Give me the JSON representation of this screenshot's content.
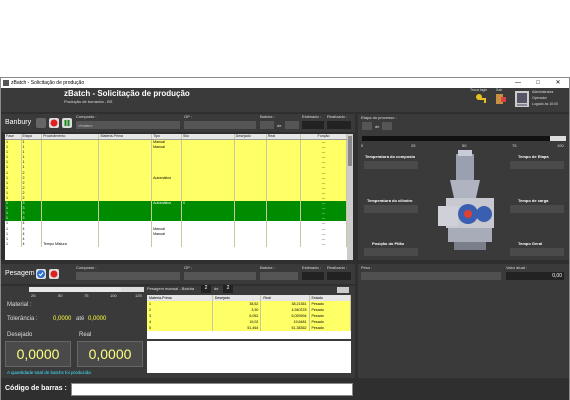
{
  "window": {
    "title": "zBatch - Solicitação de produção",
    "minimize": "—",
    "maximize": "□",
    "close": "✕"
  },
  "header": {
    "title": "zBatch - Solicitação de produção",
    "subtitle": "Produção de borracha - BS",
    "icons": [
      {
        "name": "troca-login",
        "label": "Troca login"
      },
      {
        "name": "sair",
        "label": "Sair"
      }
    ],
    "user": {
      "name": "Administrador",
      "role": "Operador",
      "login": "Logado às 10:00"
    }
  },
  "banbury": {
    "name": "Banbury",
    "composto_label": "Composto :",
    "composto_value": "Vedatex",
    "op_label": "OP :",
    "batcha_label": "Batcha :",
    "de": "de",
    "estimado_label": "Estimado :",
    "realizado_label": "Realizado :"
  },
  "grid": {
    "columns": [
      "Fase",
      "Etapa",
      "Procedimento",
      "Materia-Prima",
      "Tipo",
      "Silo",
      "Desejado",
      "Real",
      "Função"
    ],
    "rows": [
      {
        "style": "y",
        "cells": [
          "1",
          "1",
          "",
          "",
          "Manual",
          "",
          "",
          "",
          "---"
        ]
      },
      {
        "style": "y",
        "cells": [
          "1",
          "1",
          "",
          "",
          "Manual",
          "",
          "",
          "",
          "---"
        ]
      },
      {
        "style": "y",
        "cells": [
          "1",
          "1",
          "",
          "",
          "",
          "",
          "",
          "",
          "---"
        ]
      },
      {
        "style": "y",
        "cells": [
          "1",
          "1",
          "",
          "",
          "",
          "",
          "",
          "",
          "---"
        ]
      },
      {
        "style": "y",
        "cells": [
          "1",
          "1",
          "",
          "",
          "",
          "",
          "",
          "",
          "---"
        ]
      },
      {
        "style": "y",
        "cells": [
          "1",
          "1",
          "",
          "",
          "",
          "",
          "",
          "",
          "---"
        ]
      },
      {
        "style": "y",
        "cells": [
          "1",
          "2",
          "",
          "",
          "",
          "",
          "",
          "",
          "---"
        ]
      },
      {
        "style": "y",
        "cells": [
          "1",
          "2",
          "",
          "",
          "Automático",
          "",
          "",
          "",
          "---"
        ]
      },
      {
        "style": "y",
        "cells": [
          "1",
          "2",
          "",
          "",
          "",
          "",
          "",
          "",
          "---"
        ]
      },
      {
        "style": "y",
        "cells": [
          "1",
          "2",
          "",
          "",
          "",
          "",
          "",
          "",
          "---"
        ]
      },
      {
        "style": "y",
        "cells": [
          "1",
          "2",
          "",
          "",
          "",
          "",
          "",
          "",
          "---"
        ]
      },
      {
        "style": "y",
        "cells": [
          "1",
          "2",
          "",
          "",
          "",
          "",
          "",
          "",
          "---"
        ]
      },
      {
        "style": "g",
        "cells": [
          "1",
          "3",
          "",
          "",
          "Automático",
          "0",
          "",
          "",
          "---"
        ]
      },
      {
        "style": "g",
        "cells": [
          "1",
          "3",
          "",
          "",
          "",
          "",
          "",
          "",
          "---"
        ]
      },
      {
        "style": "g",
        "cells": [
          "1",
          "3",
          "",
          "",
          "",
          "",
          "",
          "",
          "---"
        ]
      },
      {
        "style": "g",
        "cells": [
          "1",
          "3",
          "",
          "",
          "",
          "",
          "",
          "",
          "---"
        ]
      },
      {
        "style": "w",
        "cells": [
          "1",
          "4",
          "",
          "",
          "",
          "",
          "",
          "",
          "---"
        ]
      },
      {
        "style": "w",
        "cells": [
          "1",
          "4",
          "",
          "",
          "Manual",
          "",
          "",
          "",
          "---"
        ]
      },
      {
        "style": "w",
        "cells": [
          "1",
          "4",
          "",
          "",
          "Manual",
          "",
          "",
          "",
          "---"
        ]
      },
      {
        "style": "w",
        "cells": [
          "1",
          "4",
          "",
          "",
          "",
          "",
          "",
          "",
          "---"
        ]
      },
      {
        "style": "w",
        "cells": [
          "1",
          "4",
          "Tempo Mistura",
          "",
          "",
          "",
          "",
          "",
          "---"
        ]
      }
    ]
  },
  "etapa": {
    "label": "Etapa do processo :",
    "de": "de",
    "scale": [
      "0",
      "25",
      "50",
      "75",
      "100"
    ],
    "progress": 0.92,
    "readouts": {
      "temp_composto": "Temperatura do composto",
      "tempo_etapa": "Tempo de Etapa",
      "temp_cilindro": "Temperatura do cilindro",
      "tempo_carga": "Tempo de carga",
      "posicao_pilao": "Posição do Pilão",
      "tempo_geral": "Tempo Geral"
    }
  },
  "pesagem": {
    "name": "Pesagem",
    "composto_label": "Composto :",
    "op_label": "OP :",
    "batcha_label": "Batcha :",
    "estimado_label": "Estimado :",
    "realizado_label": "Realizado :",
    "scale": [
      "25",
      "50",
      "75",
      "100",
      "125"
    ],
    "progress": 0.8,
    "manual_label": "Pesagem manual - Batcha",
    "manual_from": "2",
    "manual_de": "de",
    "manual_to": "2",
    "material_label": "Material :",
    "tolerancia_label": "Tolerância :",
    "tolerancia_min": "0,0000",
    "ate": "até",
    "tolerancia_max": "0,0000",
    "desejado_label": "Desejado",
    "real_label": "Real",
    "desejado_value": "0,0000",
    "real_value": "0,0000",
    "message": "A quantidade total de batchs foi produzida"
  },
  "pes_table": {
    "columns": [
      "Materia-Prima",
      "Desejado",
      "Real",
      "Estado"
    ],
    "rows": [
      [
        "1",
        "38,52",
        "38,21361",
        "Pesado"
      ],
      [
        "2",
        "3,90",
        "4,940378",
        "Pesado"
      ],
      [
        "3",
        "6,052",
        "6,053994",
        "Pesado"
      ],
      [
        "4",
        "19,02",
        "19,6481",
        "Pesado"
      ],
      [
        "5",
        "51,464",
        "51,38362",
        "Pesado"
      ]
    ]
  },
  "peso": {
    "label": "Peso :",
    "valor_label": "Valor atual :",
    "valor": "0,00"
  },
  "barcode": {
    "label": "Código de barras :",
    "value": ""
  }
}
